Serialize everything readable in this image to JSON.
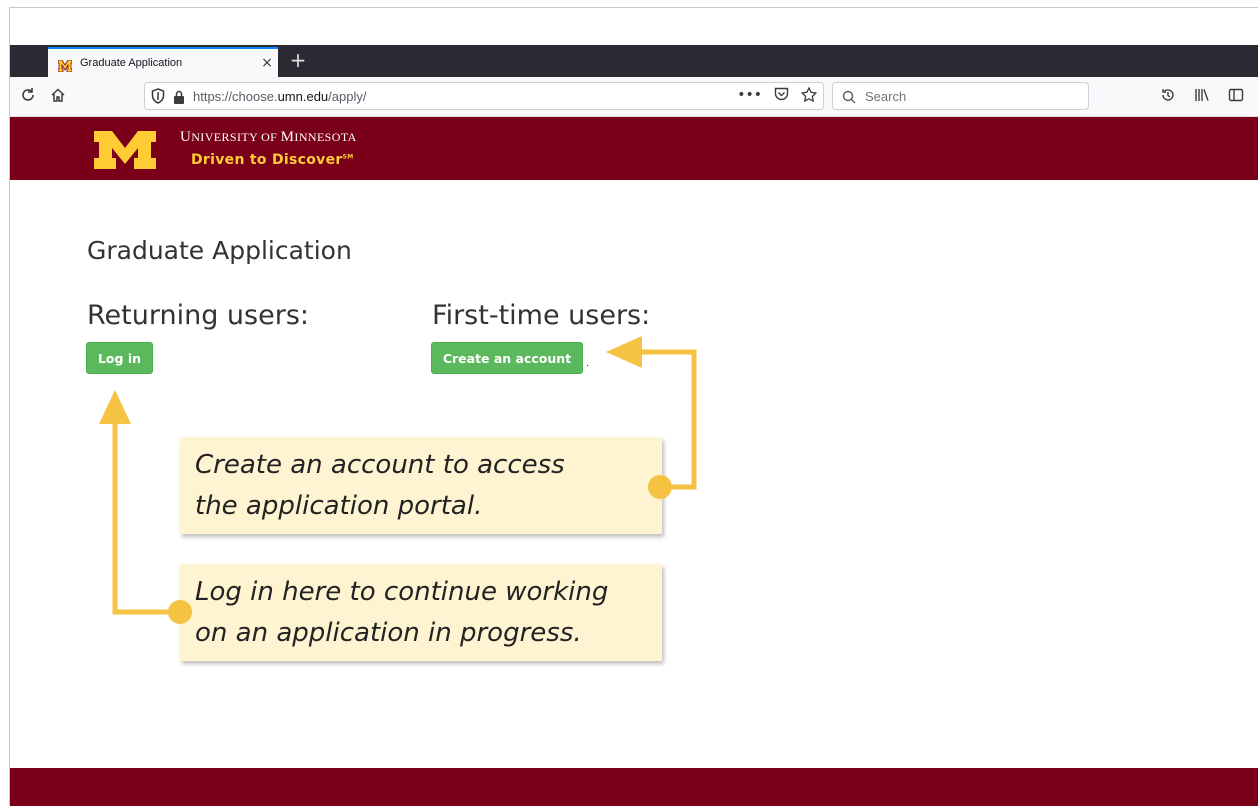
{
  "browser": {
    "tab": {
      "title": "Graduate Application",
      "close_glyph": "×"
    },
    "new_tab_glyph": "+",
    "url": {
      "prefix": "https://choose.",
      "domain": "umn.edu",
      "path": "/apply/"
    },
    "url_actions": [
      "•••",
      "pocket-icon",
      "star-icon"
    ],
    "search_placeholder": "Search",
    "toolbar_icons": [
      "history-icon",
      "library-icon",
      "sidebar-icon"
    ]
  },
  "header": {
    "university_name": {
      "u": "U",
      "niversity": "NIVERSITY",
      "of": " OF ",
      "m": "M",
      "innesota": "INNESOTA"
    },
    "tagline": "Driven to Discover",
    "tagline_mark": "SM",
    "brand_maroon": "#7a0019",
    "brand_gold": "#ffcc33"
  },
  "main": {
    "title": "Graduate Application",
    "returning": {
      "heading": "Returning users:",
      "button": "Log in"
    },
    "first_time": {
      "heading": "First-time users:",
      "button": "Create an account"
    },
    "trailing_dot": "."
  },
  "callouts": {
    "create": {
      "line1": "Create an account to access",
      "line2": "the application portal."
    },
    "login": {
      "line1": "Log in here to continue working",
      "line2": "on an application in progress."
    }
  },
  "colors": {
    "button_green": "#5cb85c",
    "callout_bg": "#fef4d1",
    "arrow_yellow": "#f5c242"
  }
}
